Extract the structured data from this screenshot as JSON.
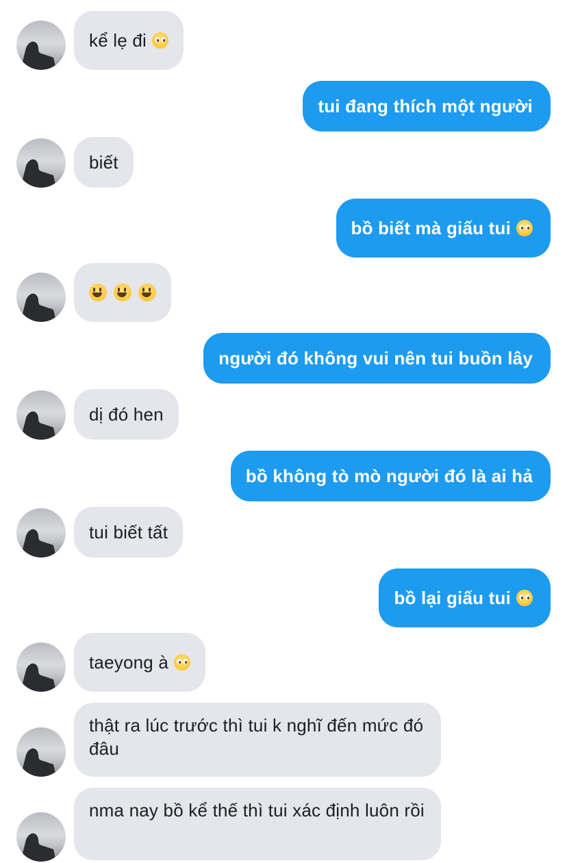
{
  "messages": [
    {
      "dir": "in",
      "text": "kể lẹ đi",
      "emoji": "pleading-face"
    },
    {
      "dir": "out",
      "text": "tui đang thích một người"
    },
    {
      "dir": "in",
      "text": "biết"
    },
    {
      "dir": "out",
      "text": "bồ biết mà giấu tui",
      "emoji": "pleading-face"
    },
    {
      "dir": "in",
      "text": "",
      "emoji": "smiley x3"
    },
    {
      "dir": "out",
      "text": "người đó không vui nên tui buồn lây"
    },
    {
      "dir": "in",
      "text": "dị đó hen"
    },
    {
      "dir": "out",
      "text": "bồ không tò mò người đó là ai hả"
    },
    {
      "dir": "in",
      "text": "tui biết tất"
    },
    {
      "dir": "out",
      "text": "bồ lại giấu tui",
      "emoji": "pleading-face"
    },
    {
      "dir": "in",
      "text": "taeyong à",
      "emoji": "pleading-face"
    },
    {
      "dir": "in",
      "text": "thật ra lúc trước thì tui k nghĩ đến mức đó đâu"
    },
    {
      "dir": "in",
      "text": "nma nay bồ kể thế thì tui xác định luôn rồi"
    }
  ],
  "colors": {
    "incoming_bubble": "#e4e6eb",
    "outgoing_bubble": "#1d9bf0",
    "incoming_text": "#1c1e21",
    "outgoing_text": "#ffffff"
  }
}
